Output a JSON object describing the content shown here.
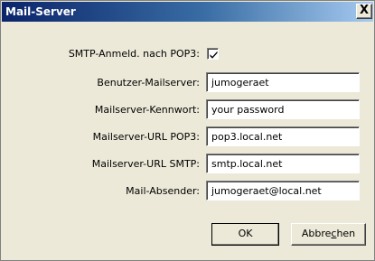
{
  "window": {
    "title": "Mail-Server",
    "close_glyph": "X"
  },
  "form": {
    "smtp_auth_label": "SMTP-Anmeld. nach POP3:",
    "smtp_auth_checked": true,
    "fields": [
      {
        "label": "Benutzer-Mailserver:",
        "value": "jumogeraet"
      },
      {
        "label": "Mailserver-Kennwort:",
        "value": "your password"
      },
      {
        "label": "Mailserver-URL POP3:",
        "value": "pop3.local.net"
      },
      {
        "label": "Mailserver-URL SMTP:",
        "value": "smtp.local.net"
      },
      {
        "label": "Mail-Absender:",
        "value": "jumogeraet@local.net"
      }
    ]
  },
  "buttons": {
    "ok_label": "OK",
    "cancel_pre": "Abbre",
    "cancel_accel": "c",
    "cancel_post": "hen"
  }
}
